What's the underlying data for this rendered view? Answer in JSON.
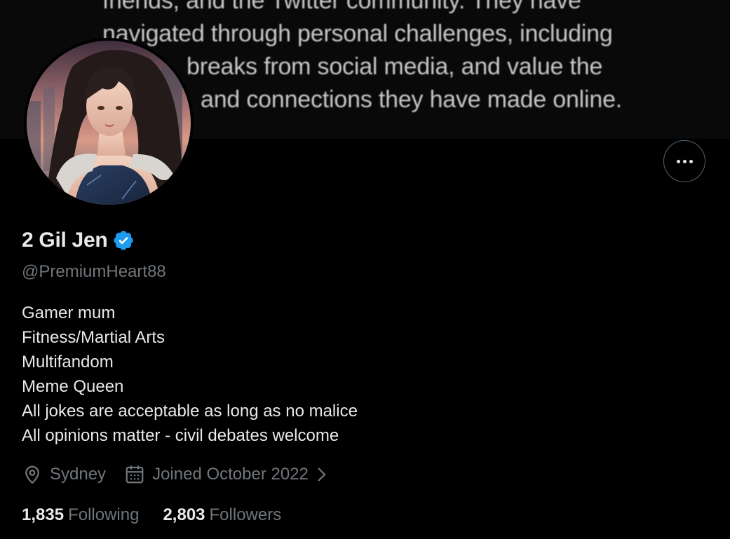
{
  "banner": {
    "lines": [
      "friends, and the Twitter community. They have",
      "navigated through personal challenges, including",
      "breaks from social media, and value the",
      "and connections they have made online."
    ]
  },
  "profile": {
    "display_name": "2 Gil Jen",
    "handle": "@PremiumHeart88",
    "verified": true,
    "verified_color": "#1d9bf0",
    "bio_lines": [
      "Gamer mum",
      "Fitness/Martial Arts",
      "Multifandom",
      "Meme Queen",
      "All jokes are acceptable as long as no malice",
      "All opinions matter - civil debates welcome"
    ],
    "location": "Sydney",
    "joined": "Joined October 2022",
    "following_count": "1,835",
    "following_label": "Following",
    "followers_count": "2,803",
    "followers_label": "Followers"
  },
  "icons": {
    "more": "more-horizontal-icon",
    "location": "location-pin-icon",
    "calendar": "calendar-icon",
    "chevron": "chevron-right-icon",
    "verified": "verified-badge-icon"
  },
  "colors": {
    "background": "#000000",
    "text_primary": "#e7e9ea",
    "text_secondary": "#71767b",
    "accent": "#1d9bf0"
  }
}
